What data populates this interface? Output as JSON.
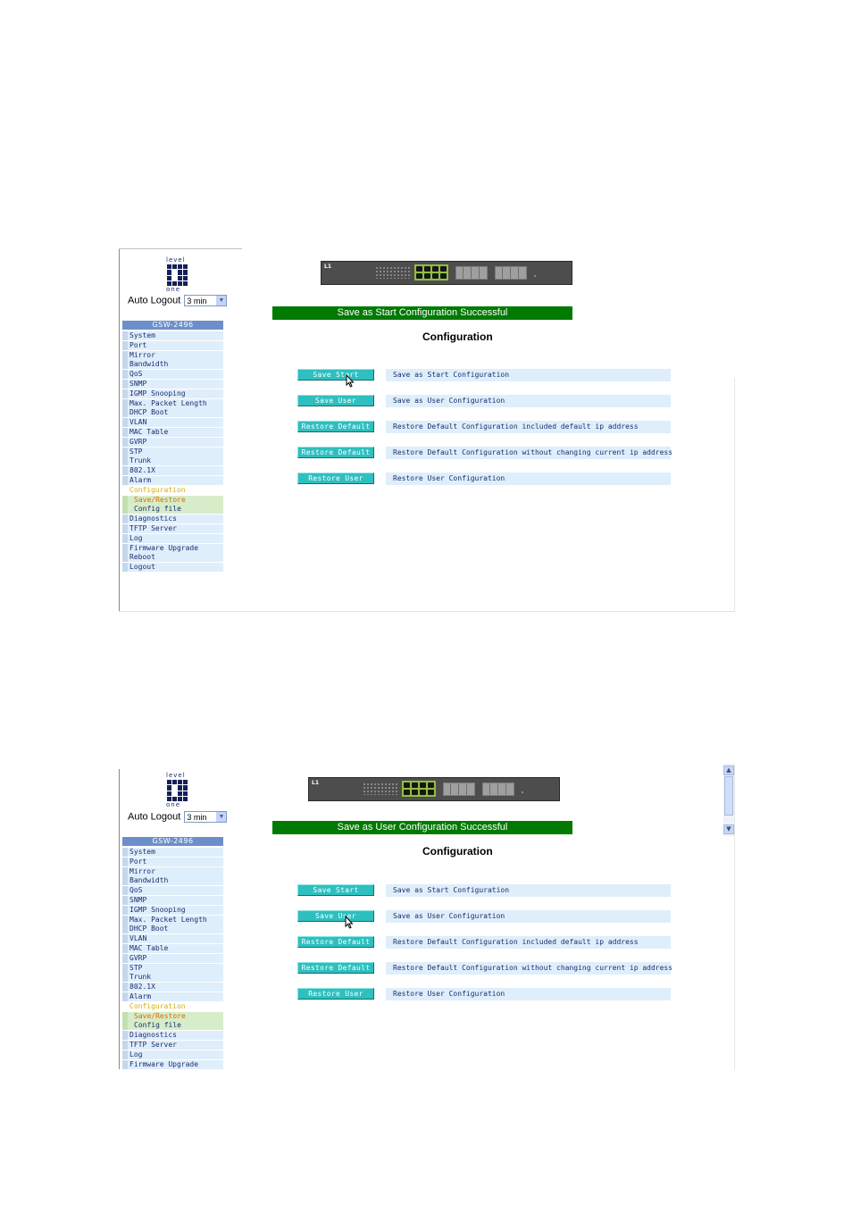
{
  "screens": [
    {
      "logo_text_top": "level",
      "logo_text_bottom": "one",
      "auto_logout_label": "Auto Logout",
      "auto_logout_value": "3 min",
      "model": "GSW-2496",
      "switch_brand": "L1",
      "menu": [
        "System",
        "Port",
        "Mirror",
        "Bandwidth",
        "QoS",
        "SNMP",
        "IGMP Snooping",
        "Max. Packet Length",
        "DHCP Boot",
        "VLAN",
        "MAC Table",
        "GVRP",
        "STP",
        "Trunk",
        "802.1X",
        "Alarm",
        "Configuration",
        "Save/Restore",
        "Config file",
        "Diagnostics",
        "TFTP Server",
        "Log",
        "Firmware Upgrade",
        "Reboot",
        "Logout"
      ],
      "banner": "Save as Start Configuration Successful",
      "heading": "Configuration",
      "rows": [
        {
          "button": "Save Start",
          "desc": "Save as Start Configuration"
        },
        {
          "button": "Save User",
          "desc": "Save as User Configuration"
        },
        {
          "button": "Restore Default",
          "desc": "Restore Default Configuration included default ip address"
        },
        {
          "button": "Restore Default",
          "desc": "Restore Default Configuration without changing current ip address"
        },
        {
          "button": "Restore User",
          "desc": "Restore User Configuration"
        }
      ]
    },
    {
      "logo_text_top": "level",
      "logo_text_bottom": "one",
      "auto_logout_label": "Auto Logout",
      "auto_logout_value": "3 min",
      "model": "GSW-2496",
      "switch_brand": "L1",
      "menu": [
        "System",
        "Port",
        "Mirror",
        "Bandwidth",
        "QoS",
        "SNMP",
        "IGMP Snooping",
        "Max. Packet Length",
        "DHCP Boot",
        "VLAN",
        "MAC Table",
        "GVRP",
        "STP",
        "Trunk",
        "802.1X",
        "Alarm",
        "Configuration",
        "Save/Restore",
        "Config file",
        "Diagnostics",
        "TFTP Server",
        "Log",
        "Firmware Upgrade"
      ],
      "banner": "Save as User Configuration Successful",
      "heading": "Configuration",
      "rows": [
        {
          "button": "Save Start",
          "desc": "Save as Start Configuration"
        },
        {
          "button": "Save User",
          "desc": "Save as User Configuration"
        },
        {
          "button": "Restore Default",
          "desc": "Restore Default Configuration included default ip address"
        },
        {
          "button": "Restore Default",
          "desc": "Restore Default Configuration without changing current ip address"
        },
        {
          "button": "Restore User",
          "desc": "Restore User Configuration"
        }
      ]
    }
  ]
}
